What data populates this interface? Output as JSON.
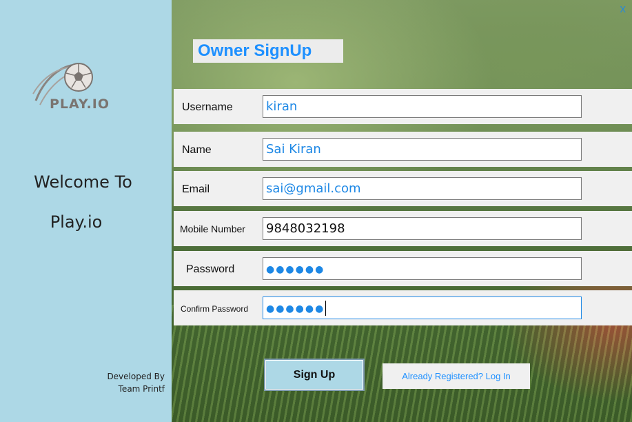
{
  "app": {
    "logo_text": "PLAY.IO",
    "welcome_line1": "Welcome To",
    "welcome_line2": "Play.io",
    "developed_by": "Developed By",
    "team": "Team Printf"
  },
  "window": {
    "close_label": "X"
  },
  "form": {
    "title": "Owner SignUp",
    "fields": [
      {
        "label": "Username",
        "value": "kiran"
      },
      {
        "label": "Name",
        "value": "Sai Kiran"
      },
      {
        "label": "Email",
        "value": "sai@gmail.com"
      },
      {
        "label": "Mobile Number",
        "value": "9848032198"
      },
      {
        "label": "Password",
        "value": "●●●●●●"
      },
      {
        "label": "Confirm Password",
        "value": "●●●●●●"
      }
    ],
    "signup_label": "Sign Up",
    "login_link_label": "Already Registered? Log In"
  },
  "colors": {
    "left_panel": "#add8e6",
    "accent": "#1e90ff",
    "button_bg": "#add8e6"
  },
  "icons": {
    "logo": "soccer-ball-icon",
    "close": "close-icon"
  }
}
